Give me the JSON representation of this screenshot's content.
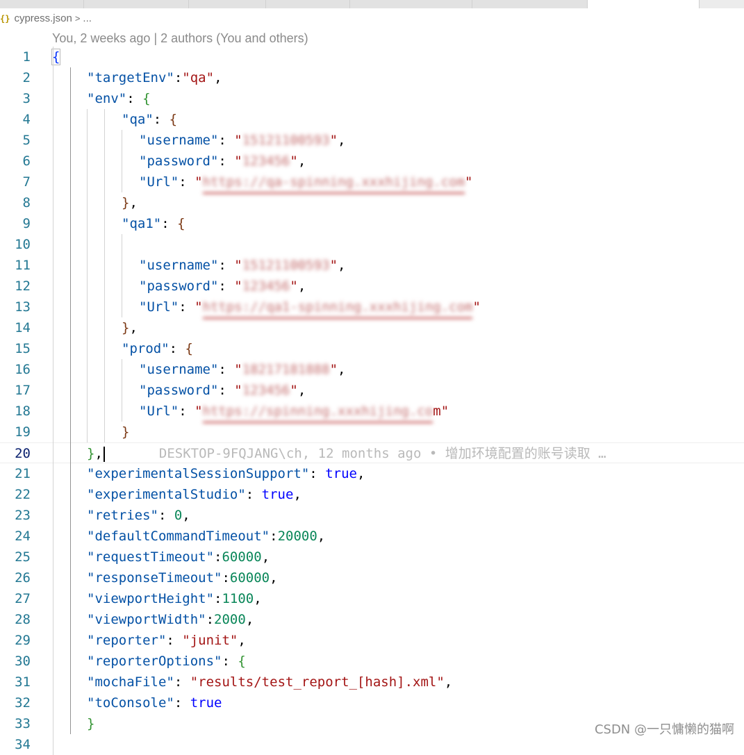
{
  "breadcrumb": {
    "icon": "json-braces-icon",
    "icon_glyph": "{}",
    "file": "cypress.json",
    "separator": ">",
    "rest": "..."
  },
  "codelens": "You, 2 weeks ago | 2 authors (You and others)",
  "current_line": 20,
  "blame": "DESKTOP-9FQJANG\\ch, 12 months ago • 增加环境配置的账号读取 …",
  "colors": {
    "key": "#0451a5",
    "string": "#a31515",
    "number": "#098658",
    "boolean": "#0000ff",
    "line_number": "#237893"
  },
  "lines": [
    {
      "n": "1",
      "indent": 0,
      "t": [
        [
          "b1",
          "{"
        ]
      ]
    },
    {
      "n": "2",
      "indent": 1,
      "t": [
        [
          "key",
          "\"targetEnv\""
        ],
        [
          "pun",
          ":"
        ],
        [
          "str",
          "\"qa\""
        ],
        [
          "pun",
          ","
        ]
      ]
    },
    {
      "n": "3",
      "indent": 1,
      "t": [
        [
          "key",
          "\"env\""
        ],
        [
          "pun",
          ": "
        ],
        [
          "b2",
          "{"
        ]
      ]
    },
    {
      "n": "4",
      "indent": 2,
      "t": [
        [
          "key",
          "\"qa\""
        ],
        [
          "pun",
          ": "
        ],
        [
          "b3",
          "{"
        ]
      ]
    },
    {
      "n": "5",
      "indent": 2,
      "pad": 1,
      "t": [
        [
          "key",
          "\"username\""
        ],
        [
          "pun",
          ": "
        ],
        [
          "str",
          "\""
        ],
        [
          "blur",
          "15121100593"
        ],
        [
          "str",
          "\""
        ],
        [
          "pun",
          ","
        ]
      ]
    },
    {
      "n": "6",
      "indent": 2,
      "pad": 1,
      "t": [
        [
          "key",
          "\"password\""
        ],
        [
          "pun",
          ": "
        ],
        [
          "str",
          "\""
        ],
        [
          "blur",
          "123456"
        ],
        [
          "str",
          "\""
        ],
        [
          "pun",
          ","
        ]
      ]
    },
    {
      "n": "7",
      "indent": 2,
      "pad": 1,
      "t": [
        [
          "key",
          "\"Url\""
        ],
        [
          "pun",
          ": "
        ],
        [
          "str",
          "\""
        ],
        [
          "blururl",
          "https://qa-spinning.xxxhijing.com"
        ],
        [
          "str",
          "\""
        ]
      ]
    },
    {
      "n": "8",
      "indent": 2,
      "t": [
        [
          "b3",
          "}"
        ],
        [
          "pun",
          ","
        ]
      ]
    },
    {
      "n": "9",
      "indent": 2,
      "t": [
        [
          "key",
          "\"qa1\""
        ],
        [
          "pun",
          ": "
        ],
        [
          "b3",
          "{"
        ]
      ]
    },
    {
      "n": "10",
      "indent": 2,
      "t": []
    },
    {
      "n": "11",
      "indent": 2,
      "pad": 1,
      "t": [
        [
          "key",
          "\"username\""
        ],
        [
          "pun",
          ": "
        ],
        [
          "str",
          "\""
        ],
        [
          "blur",
          "15121100593"
        ],
        [
          "str",
          "\""
        ],
        [
          "pun",
          ","
        ]
      ]
    },
    {
      "n": "12",
      "indent": 2,
      "pad": 1,
      "t": [
        [
          "key",
          "\"password\""
        ],
        [
          "pun",
          ": "
        ],
        [
          "str",
          "\""
        ],
        [
          "blur",
          "123456"
        ],
        [
          "str",
          "\""
        ],
        [
          "pun",
          ","
        ]
      ]
    },
    {
      "n": "13",
      "indent": 2,
      "pad": 1,
      "t": [
        [
          "key",
          "\"Url\""
        ],
        [
          "pun",
          ": "
        ],
        [
          "str",
          "\""
        ],
        [
          "blururl",
          "https://qa1-spinning.xxxhijing.com"
        ],
        [
          "str",
          "\""
        ]
      ]
    },
    {
      "n": "14",
      "indent": 2,
      "t": [
        [
          "b3",
          "}"
        ],
        [
          "pun",
          ","
        ]
      ]
    },
    {
      "n": "15",
      "indent": 2,
      "t": [
        [
          "key",
          "\"prod\""
        ],
        [
          "pun",
          ": "
        ],
        [
          "b3",
          "{"
        ]
      ]
    },
    {
      "n": "16",
      "indent": 2,
      "pad": 1,
      "t": [
        [
          "key",
          "\"username\""
        ],
        [
          "pun",
          ": "
        ],
        [
          "str",
          "\""
        ],
        [
          "blur",
          "18217181888"
        ],
        [
          "str",
          "\""
        ],
        [
          "pun",
          ","
        ]
      ]
    },
    {
      "n": "17",
      "indent": 2,
      "pad": 1,
      "t": [
        [
          "key",
          "\"password\""
        ],
        [
          "pun",
          ": "
        ],
        [
          "str",
          "\""
        ],
        [
          "blur",
          "123456"
        ],
        [
          "str",
          "\""
        ],
        [
          "pun",
          ","
        ]
      ]
    },
    {
      "n": "18",
      "indent": 2,
      "pad": 1,
      "t": [
        [
          "key",
          "\"Url\""
        ],
        [
          "pun",
          ": "
        ],
        [
          "str",
          "\""
        ],
        [
          "blururl",
          "https://spinning.xxxhijing.co"
        ],
        [
          "str",
          "m\""
        ]
      ]
    },
    {
      "n": "19",
      "indent": 2,
      "t": [
        [
          "b3",
          "}"
        ]
      ]
    },
    {
      "n": "20",
      "indent": 1,
      "t": [
        [
          "b2",
          "}"
        ],
        [
          "pun",
          ","
        ]
      ]
    },
    {
      "n": "21",
      "indent": 1,
      "t": [
        [
          "key",
          "\"experimentalSessionSupport\""
        ],
        [
          "pun",
          ": "
        ],
        [
          "bool",
          "true"
        ],
        [
          "pun",
          ","
        ]
      ]
    },
    {
      "n": "22",
      "indent": 1,
      "t": [
        [
          "key",
          "\"experimentalStudio\""
        ],
        [
          "pun",
          ": "
        ],
        [
          "bool",
          "true"
        ],
        [
          "pun",
          ","
        ]
      ]
    },
    {
      "n": "23",
      "indent": 1,
      "t": [
        [
          "key",
          "\"retries\""
        ],
        [
          "pun",
          ": "
        ],
        [
          "num",
          "0"
        ],
        [
          "pun",
          ","
        ]
      ]
    },
    {
      "n": "24",
      "indent": 1,
      "t": [
        [
          "key",
          "\"defaultCommandTimeout\""
        ],
        [
          "pun",
          ":"
        ],
        [
          "num",
          "20000"
        ],
        [
          "pun",
          ","
        ]
      ]
    },
    {
      "n": "25",
      "indent": 1,
      "t": [
        [
          "key",
          "\"requestTimeout\""
        ],
        [
          "pun",
          ":"
        ],
        [
          "num",
          "60000"
        ],
        [
          "pun",
          ","
        ]
      ]
    },
    {
      "n": "26",
      "indent": 1,
      "t": [
        [
          "key",
          "\"responseTimeout\""
        ],
        [
          "pun",
          ":"
        ],
        [
          "num",
          "60000"
        ],
        [
          "pun",
          ","
        ]
      ]
    },
    {
      "n": "27",
      "indent": 1,
      "t": [
        [
          "key",
          "\"viewportHeight\""
        ],
        [
          "pun",
          ":"
        ],
        [
          "num",
          "1100"
        ],
        [
          "pun",
          ","
        ]
      ]
    },
    {
      "n": "28",
      "indent": 1,
      "t": [
        [
          "key",
          "\"viewportWidth\""
        ],
        [
          "pun",
          ":"
        ],
        [
          "num",
          "2000"
        ],
        [
          "pun",
          ","
        ]
      ]
    },
    {
      "n": "29",
      "indent": 1,
      "t": [
        [
          "key",
          "\"reporter\""
        ],
        [
          "pun",
          ": "
        ],
        [
          "str",
          "\"junit\""
        ],
        [
          "pun",
          ","
        ]
      ]
    },
    {
      "n": "30",
      "indent": 1,
      "t": [
        [
          "key",
          "\"reporterOptions\""
        ],
        [
          "pun",
          ": "
        ],
        [
          "b2",
          "{"
        ]
      ]
    },
    {
      "n": "31",
      "indent": 1,
      "t": [
        [
          "key",
          "\"mochaFile\""
        ],
        [
          "pun",
          ": "
        ],
        [
          "str",
          "\"results/test_report_[hash].xml\""
        ],
        [
          "pun",
          ","
        ]
      ]
    },
    {
      "n": "32",
      "indent": 1,
      "t": [
        [
          "key",
          "\"toConsole\""
        ],
        [
          "pun",
          ": "
        ],
        [
          "bool",
          "true"
        ]
      ]
    },
    {
      "n": "33",
      "indent": 1,
      "t": [
        [
          "b2",
          "}"
        ]
      ]
    },
    {
      "n": "34",
      "indent": 0,
      "t": []
    }
  ],
  "watermark": "CSDN @一只慵懒的猫啊"
}
